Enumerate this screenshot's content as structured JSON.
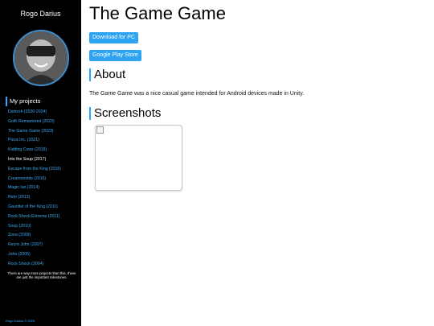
{
  "sidebar": {
    "site_name": "Rogo Darius",
    "projects_heading": "My projects",
    "projects": [
      "Darkroh (2020-2024)",
      "GolK Remastered (2023)",
      "The Game Game (2023)",
      "Pizza Inc. (2021)",
      "Kidding Cows (2019)",
      "Into the Soup (2017)",
      "Escape from the King (2016)",
      "Creamonoids (2015)",
      "Magic Ian (2014)",
      "Reto (2013)",
      "Gauntlet of the King (2011)",
      "Rock Shock Extreme (2011)",
      "Soup (2010)",
      "Zone (2009)",
      "Recre John (2007)",
      "John (2005)",
      "Rock Shock (2004)"
    ],
    "note": "There are way more projects than this, these are just the important milestones.",
    "footer": "Rogo Darius © 2024"
  },
  "main": {
    "title": "The Game Game",
    "buttons": [
      "Download for PC",
      "Google Play Store"
    ],
    "about_heading": "About",
    "about_text": "The Game Game was a nice casual game intended for Android devices made in Unity.",
    "screenshots_heading": "Screenshots"
  },
  "colors": {
    "sidebar_bg": "#000000",
    "accent": "#2ea3f2",
    "link": "#3daaf5"
  },
  "icons": {
    "broken_image": "broken-image-icon"
  }
}
